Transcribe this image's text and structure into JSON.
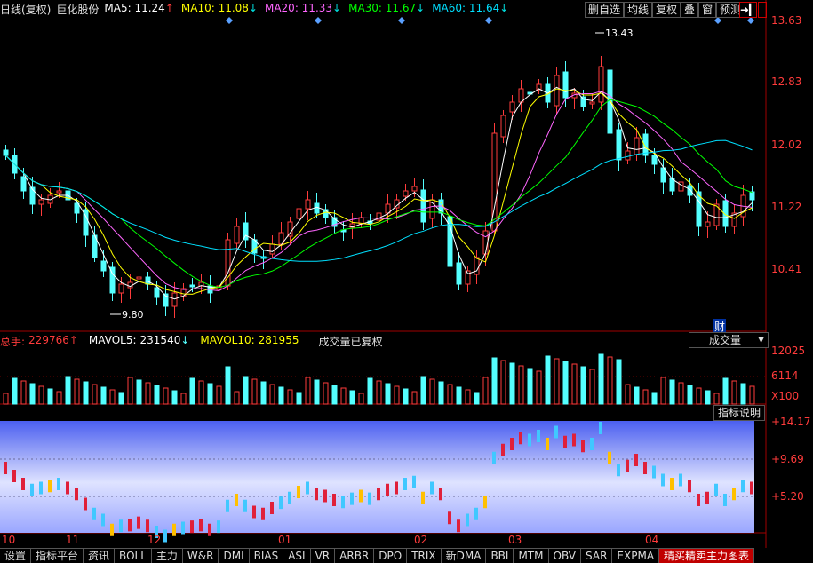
{
  "header": {
    "period_label": "日线(复权)",
    "stock_name": "巨化股份",
    "ma": [
      {
        "label": "MA5: 11.24",
        "arrow": "↑",
        "color": "#ffffff",
        "arrow_color": "#ff3b3b"
      },
      {
        "label": "MA10: 11.08",
        "arrow": "↓",
        "color": "#ffff00",
        "arrow_color": "#00e0e0"
      },
      {
        "label": "MA20: 11.33",
        "arrow": "↓",
        "color": "#ff66ff",
        "arrow_color": "#00e0e0"
      },
      {
        "label": "MA30: 11.67",
        "arrow": "↓",
        "color": "#00ff00",
        "arrow_color": "#00e0e0"
      },
      {
        "label": "MA60: 11.64",
        "arrow": "↓",
        "color": "#00e0ff",
        "arrow_color": "#00e0e0"
      }
    ]
  },
  "toolbar": {
    "buttons": [
      "删自选",
      "均线",
      "复权",
      "叠",
      "窗",
      "预测"
    ],
    "arrow_glyph": "➜▎"
  },
  "price_axis": [
    "13.63",
    "12.83",
    "12.02",
    "11.22",
    "10.41"
  ],
  "annotations": {
    "high_label": "13.43",
    "low_label": "9.80",
    "cai_badge": "财"
  },
  "volume_panel": {
    "total_label": "总手:",
    "total_value": "229766",
    "total_arrow": "↑",
    "mavol5_label": "MAVOL5:",
    "mavol5_value": "231540",
    "mavol5_arrow": "↓",
    "mavol10_label": "MAVOL10:",
    "mavol10_value": "281955",
    "note": "成交量已复权",
    "dropdown_label": "成交量",
    "dropdown_arrow": "▼",
    "ticks": [
      "12025",
      "6114",
      "X100"
    ]
  },
  "indicator_panel": {
    "help_button": "指标说明",
    "ticks": [
      "+14.17",
      "+9.69",
      "+5.20"
    ]
  },
  "months": [
    "10",
    "11",
    "12",
    "01",
    "02",
    "03",
    "04"
  ],
  "tabs": [
    "设置",
    "指标平台",
    "资讯",
    "BOLL",
    "主力",
    "W&R",
    "DMI",
    "BIAS",
    "ASI",
    "VR",
    "ARBR",
    "DPO",
    "TRIX",
    "新DMA",
    "BBI",
    "MTM",
    "OBV",
    "SAR",
    "EXPMA",
    "精买精卖主力图表"
  ],
  "active_tab": "精买精卖主力图表",
  "colors": {
    "up": "#ff3b3b",
    "down": "#54ffff",
    "ma5": "#ffffff",
    "ma10": "#ffff00",
    "ma20": "#ff66ff",
    "ma30": "#00ff00",
    "ma60": "#00e0ff",
    "grid_red": "#a00000",
    "indicator_bg_top": "#5a6cf0",
    "indicator_bg_bottom": "#ffffff"
  }
}
